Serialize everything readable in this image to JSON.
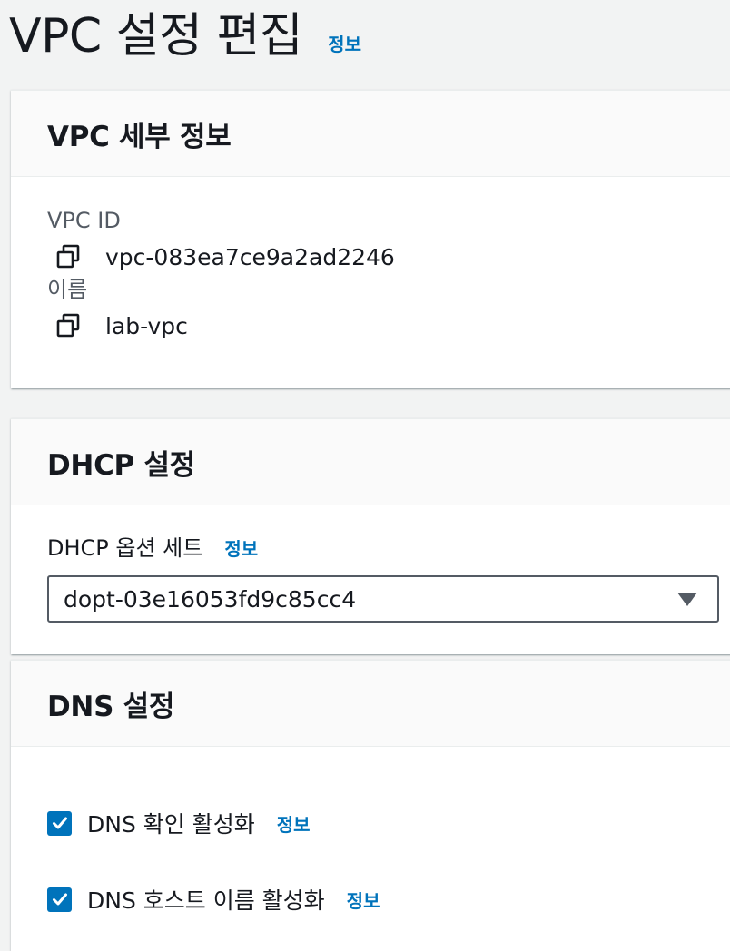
{
  "page": {
    "title": "VPC 설정 편집",
    "info_link": "정보"
  },
  "vpc_details": {
    "title": "VPC 세부 정보",
    "vpc_id_label": "VPC ID",
    "vpc_id_value": "vpc-083ea7ce9a2ad2246",
    "name_label": "이름",
    "name_value": "lab-vpc"
  },
  "dhcp": {
    "title": "DHCP 설정",
    "option_set_label": "DHCP 옵션 세트",
    "info_link": "정보",
    "selected_option": "dopt-03e16053fd9c85cc4"
  },
  "dns": {
    "title": "DNS 설정",
    "options": [
      {
        "label": "DNS 확인 활성화",
        "info_link": "정보",
        "checked": true
      },
      {
        "label": "DNS 호스트 이름 활성화",
        "info_link": "정보",
        "checked": true
      }
    ]
  },
  "colors": {
    "accent": "#0073bb",
    "background": "#f2f3f3",
    "panel_header": "#fafafa",
    "label_text": "#545b64"
  },
  "icons": {
    "copy": "copy-icon",
    "dropdown": "caret-down-icon",
    "checkbox": "checkmark-icon"
  }
}
